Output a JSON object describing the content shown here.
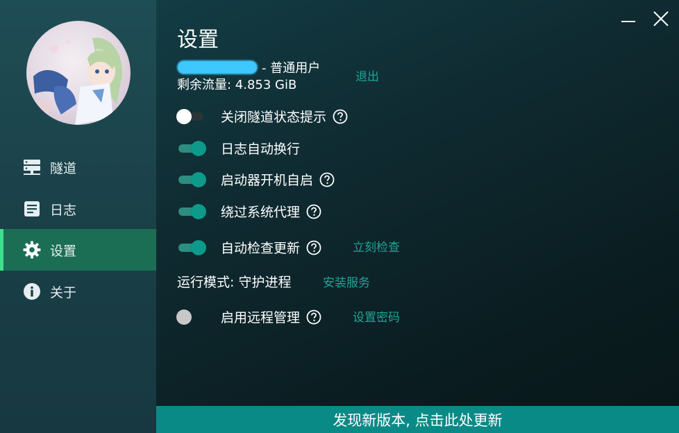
{
  "sidebar": {
    "items": [
      {
        "label": "隧道",
        "icon": "server-icon",
        "active": false
      },
      {
        "label": "日志",
        "icon": "document-icon",
        "active": false
      },
      {
        "label": "设置",
        "icon": "gear-icon",
        "active": true
      },
      {
        "label": "关于",
        "icon": "info-icon",
        "active": false
      }
    ]
  },
  "main": {
    "title": "设置",
    "user": {
      "role_suffix": "- 普通用户",
      "logout_label": "退出"
    },
    "traffic": "剩余流量: 4.853 GiB",
    "settings": [
      {
        "label": "关闭隧道状态提示",
        "state": "off",
        "help": true
      },
      {
        "label": "日志自动换行",
        "state": "on",
        "help": false
      },
      {
        "label": "启动器开机自启",
        "state": "on",
        "help": true
      },
      {
        "label": "绕过系统代理",
        "state": "on",
        "help": true
      },
      {
        "label": "自动检查更新",
        "state": "on",
        "help": true,
        "link": "立刻检查"
      }
    ],
    "run_mode": {
      "label": "运行模式: 守护进程",
      "link": "安装服务"
    },
    "remote": {
      "label": "启用远程管理",
      "state": "disabled",
      "help": true,
      "link": "设置密码"
    }
  },
  "update_bar": "发现新版本, 点击此处更新",
  "colors": {
    "accent": "#1fa596",
    "toggle_on": "#0d9a8a",
    "nav_active": "#1b6e54",
    "nav_active_bar": "#3ee08e",
    "update_bar": "#0a8a86"
  }
}
